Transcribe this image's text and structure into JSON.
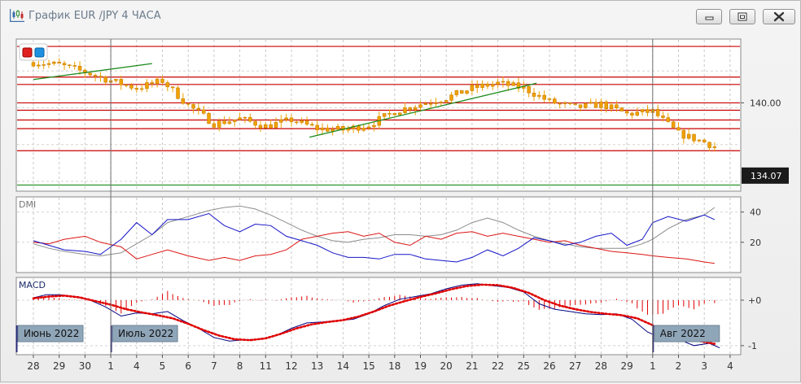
{
  "window": {
    "title": "График EUR /JPY  4 ЧАСА",
    "icon": "candlestick-chart-icon",
    "controls": [
      "minimize-icon",
      "maximize-icon",
      "close-icon"
    ]
  },
  "colors": {
    "candle": "#f0a000",
    "resistance_lines": "#c80000",
    "trend_lines": "#1e8c1e",
    "support_line": "#1e8c1e",
    "dmi_plus": "#1414c8",
    "dmi_minus": "#dc1414",
    "adx": "#8c8c8c",
    "macd_line": "#000080",
    "macd_signal": "#e00000",
    "macd_hist": "#e00000",
    "period_label_bg": "#8fa5b8"
  },
  "chart_data": {
    "type": "candlestick",
    "symbol": "EUR/JPY",
    "timeframe": "4 ЧАСА",
    "x_labels": [
      "28",
      "29",
      "30",
      "1",
      "4",
      "5",
      "6",
      "7",
      "8",
      "11",
      "12",
      "13",
      "14",
      "15",
      "18",
      "19",
      "20",
      "21",
      "22",
      "25",
      "26",
      "27",
      "28",
      "29",
      "1",
      "2",
      "3",
      "4"
    ],
    "period_labels": [
      "Июнь 2022",
      "Июль 2022",
      "Авг 2022"
    ],
    "price_axis": {
      "ticks": [
        "140.00"
      ],
      "last_price": "134.07"
    },
    "price_trend_path": [
      [
        0,
        143.3
      ],
      [
        1,
        143.1
      ],
      [
        2,
        142.5
      ],
      [
        3,
        141.8
      ],
      [
        4,
        141.2
      ],
      [
        5,
        141.8
      ],
      [
        6,
        139.8
      ],
      [
        7,
        138.3
      ],
      [
        8,
        138.7
      ],
      [
        9,
        138.1
      ],
      [
        10,
        138.6
      ],
      [
        11,
        137.9
      ],
      [
        12,
        137.8
      ],
      [
        13,
        138.2
      ],
      [
        14,
        139.3
      ],
      [
        15,
        139.9
      ],
      [
        16,
        140.4
      ],
      [
        17,
        141.2
      ],
      [
        18,
        141.6
      ],
      [
        19,
        141.2
      ],
      [
        20,
        140.1
      ],
      [
        21,
        139.6
      ],
      [
        22,
        139.9
      ],
      [
        23,
        139.1
      ],
      [
        24,
        139.3
      ],
      [
        25,
        137.5
      ],
      [
        26,
        136.8
      ],
      [
        27,
        135.9
      ],
      [
        28,
        135.5
      ],
      [
        29,
        134.5
      ]
    ],
    "horizontal_levels": [
      144.6,
      142.1,
      141.5,
      140.0,
      139.4,
      138.6,
      137.9,
      136.1
    ],
    "support_level": 133.3,
    "trend_lines": [
      {
        "from": [
          0,
          141.9
        ],
        "to": [
          4.6,
          143.2
        ]
      },
      {
        "from": [
          10.7,
          137.2
        ],
        "to": [
          19.5,
          141.6
        ]
      }
    ],
    "dmi": {
      "label": "DMI",
      "y_ticks": [
        20,
        40
      ],
      "y_range": [
        0,
        50
      ],
      "plus_di": [
        [
          0,
          21
        ],
        [
          0.6,
          18
        ],
        [
          1.2,
          15
        ],
        [
          2,
          14
        ],
        [
          2.6,
          12
        ],
        [
          3.4,
          22
        ],
        [
          4,
          33
        ],
        [
          4.6,
          25
        ],
        [
          5.2,
          35
        ],
        [
          6,
          35
        ],
        [
          6.8,
          39
        ],
        [
          7.4,
          31
        ],
        [
          8,
          27
        ],
        [
          8.6,
          32
        ],
        [
          9.2,
          31
        ],
        [
          9.8,
          24
        ],
        [
          10.4,
          21
        ],
        [
          11,
          18
        ],
        [
          11.6,
          13
        ],
        [
          12.2,
          10
        ],
        [
          12.8,
          10
        ],
        [
          13.4,
          9
        ],
        [
          14,
          12
        ],
        [
          14.6,
          12
        ],
        [
          15.2,
          9
        ],
        [
          15.8,
          8
        ],
        [
          16.4,
          7
        ],
        [
          17,
          10
        ],
        [
          17.6,
          15
        ],
        [
          18.2,
          11
        ],
        [
          18.8,
          16
        ],
        [
          19.4,
          23
        ],
        [
          20,
          21
        ],
        [
          20.6,
          18
        ],
        [
          21.2,
          20
        ],
        [
          21.8,
          24
        ],
        [
          22.4,
          26
        ],
        [
          23,
          18
        ],
        [
          23.6,
          22
        ],
        [
          24,
          33
        ],
        [
          24.6,
          37
        ],
        [
          25.3,
          34
        ],
        [
          26,
          38
        ],
        [
          26.4,
          35
        ]
      ],
      "minus_di": [
        [
          0,
          20
        ],
        [
          0.6,
          19
        ],
        [
          1.2,
          22
        ],
        [
          2,
          24
        ],
        [
          2.6,
          20
        ],
        [
          3.4,
          17
        ],
        [
          4,
          9
        ],
        [
          4.6,
          12
        ],
        [
          5.2,
          15
        ],
        [
          6,
          11
        ],
        [
          6.8,
          8
        ],
        [
          7.4,
          10
        ],
        [
          8,
          8
        ],
        [
          8.6,
          11
        ],
        [
          9.2,
          12
        ],
        [
          9.8,
          15
        ],
        [
          10.4,
          22
        ],
        [
          11,
          24
        ],
        [
          11.6,
          26
        ],
        [
          12.2,
          27
        ],
        [
          12.8,
          24
        ],
        [
          13.4,
          26
        ],
        [
          14,
          20
        ],
        [
          14.6,
          18
        ],
        [
          15.2,
          24
        ],
        [
          15.8,
          22
        ],
        [
          16.4,
          26
        ],
        [
          17,
          27
        ],
        [
          17.6,
          24
        ],
        [
          18.2,
          26
        ],
        [
          18.8,
          24
        ],
        [
          19.4,
          22
        ],
        [
          20,
          20
        ],
        [
          20.6,
          21
        ],
        [
          21.2,
          18
        ],
        [
          21.8,
          16
        ],
        [
          22.4,
          14
        ],
        [
          23,
          13
        ],
        [
          23.6,
          12
        ],
        [
          24,
          11
        ],
        [
          24.6,
          10
        ],
        [
          25.3,
          9
        ],
        [
          26,
          7
        ],
        [
          26.4,
          6
        ]
      ],
      "adx": [
        [
          0,
          19
        ],
        [
          0.6,
          16
        ],
        [
          1.2,
          14
        ],
        [
          2,
          12
        ],
        [
          2.6,
          11
        ],
        [
          3.4,
          13
        ],
        [
          4,
          19
        ],
        [
          4.6,
          25
        ],
        [
          5.2,
          33
        ],
        [
          6,
          37
        ],
        [
          6.8,
          41
        ],
        [
          7.4,
          43
        ],
        [
          8,
          44
        ],
        [
          8.6,
          42
        ],
        [
          9.2,
          38
        ],
        [
          9.8,
          33
        ],
        [
          10.4,
          28
        ],
        [
          11,
          24
        ],
        [
          11.6,
          21
        ],
        [
          12.2,
          20
        ],
        [
          12.8,
          22
        ],
        [
          13.4,
          23
        ],
        [
          14,
          25
        ],
        [
          14.6,
          25
        ],
        [
          15.2,
          24
        ],
        [
          15.8,
          25
        ],
        [
          16.4,
          28
        ],
        [
          17,
          33
        ],
        [
          17.6,
          36
        ],
        [
          18.2,
          33
        ],
        [
          18.8,
          28
        ],
        [
          19.4,
          24
        ],
        [
          20,
          21
        ],
        [
          20.6,
          19
        ],
        [
          21.2,
          17
        ],
        [
          21.8,
          16
        ],
        [
          22.4,
          16
        ],
        [
          23,
          16
        ],
        [
          23.6,
          19
        ],
        [
          24,
          22
        ],
        [
          24.6,
          29
        ],
        [
          25.3,
          35
        ],
        [
          26,
          38
        ],
        [
          26.4,
          43
        ]
      ]
    },
    "macd": {
      "label": "MACD",
      "y_ticks": [
        "+0",
        "-1"
      ],
      "y_range": [
        -1.2,
        0.5
      ],
      "macd_line": [
        [
          0,
          0.05
        ],
        [
          0.5,
          0.12
        ],
        [
          1,
          0.12
        ],
        [
          1.6,
          0.08
        ],
        [
          2.2,
          0.0
        ],
        [
          2.8,
          -0.15
        ],
        [
          3.4,
          -0.35
        ],
        [
          4,
          -0.28
        ],
        [
          4.6,
          -0.3
        ],
        [
          5.2,
          -0.25
        ],
        [
          5.8,
          -0.45
        ],
        [
          6.4,
          -0.62
        ],
        [
          7,
          -0.82
        ],
        [
          7.6,
          -0.9
        ],
        [
          8.2,
          -0.87
        ],
        [
          8.8,
          -0.86
        ],
        [
          9.4,
          -0.78
        ],
        [
          10,
          -0.62
        ],
        [
          10.6,
          -0.5
        ],
        [
          11.2,
          -0.48
        ],
        [
          11.8,
          -0.45
        ],
        [
          12.4,
          -0.42
        ],
        [
          13,
          -0.3
        ],
        [
          13.6,
          -0.12
        ],
        [
          14.2,
          0.02
        ],
        [
          14.8,
          0.08
        ],
        [
          15.4,
          0.14
        ],
        [
          16,
          0.25
        ],
        [
          16.6,
          0.33
        ],
        [
          17.2,
          0.36
        ],
        [
          17.8,
          0.32
        ],
        [
          18.4,
          0.28
        ],
        [
          19,
          0.18
        ],
        [
          19.6,
          -0.08
        ],
        [
          20.2,
          -0.2
        ],
        [
          20.8,
          -0.25
        ],
        [
          21.4,
          -0.3
        ],
        [
          22,
          -0.32
        ],
        [
          22.6,
          -0.3
        ],
        [
          23.2,
          -0.42
        ],
        [
          23.8,
          -0.7
        ],
        [
          24.4,
          -0.85
        ],
        [
          25,
          -0.86
        ],
        [
          25.6,
          -1.0
        ],
        [
          26.2,
          -0.95
        ],
        [
          26.6,
          -1.05
        ]
      ],
      "signal_line": [
        [
          0,
          0.04
        ],
        [
          0.6,
          0.08
        ],
        [
          1.2,
          0.1
        ],
        [
          1.8,
          0.06
        ],
        [
          2.4,
          -0.02
        ],
        [
          3,
          -0.1
        ],
        [
          3.6,
          -0.2
        ],
        [
          4.2,
          -0.27
        ],
        [
          4.8,
          -0.33
        ],
        [
          5.4,
          -0.4
        ],
        [
          6,
          -0.52
        ],
        [
          6.6,
          -0.66
        ],
        [
          7.2,
          -0.78
        ],
        [
          7.8,
          -0.86
        ],
        [
          8.4,
          -0.88
        ],
        [
          9,
          -0.84
        ],
        [
          9.6,
          -0.74
        ],
        [
          10.2,
          -0.62
        ],
        [
          10.8,
          -0.53
        ],
        [
          11.4,
          -0.48
        ],
        [
          12,
          -0.44
        ],
        [
          12.6,
          -0.36
        ],
        [
          13.2,
          -0.25
        ],
        [
          13.8,
          -0.12
        ],
        [
          14.4,
          -0.02
        ],
        [
          15,
          0.07
        ],
        [
          15.6,
          0.15
        ],
        [
          16.2,
          0.24
        ],
        [
          16.8,
          0.31
        ],
        [
          17.4,
          0.34
        ],
        [
          18,
          0.33
        ],
        [
          18.6,
          0.27
        ],
        [
          19.2,
          0.16
        ],
        [
          19.8,
          0.0
        ],
        [
          20.4,
          -0.12
        ],
        [
          21,
          -0.2
        ],
        [
          21.6,
          -0.26
        ],
        [
          22.2,
          -0.3
        ],
        [
          22.8,
          -0.33
        ],
        [
          23.4,
          -0.4
        ],
        [
          24,
          -0.55
        ],
        [
          24.6,
          -0.72
        ],
        [
          25.2,
          -0.82
        ],
        [
          25.8,
          -0.9
        ],
        [
          26.4,
          -0.96
        ]
      ]
    }
  }
}
